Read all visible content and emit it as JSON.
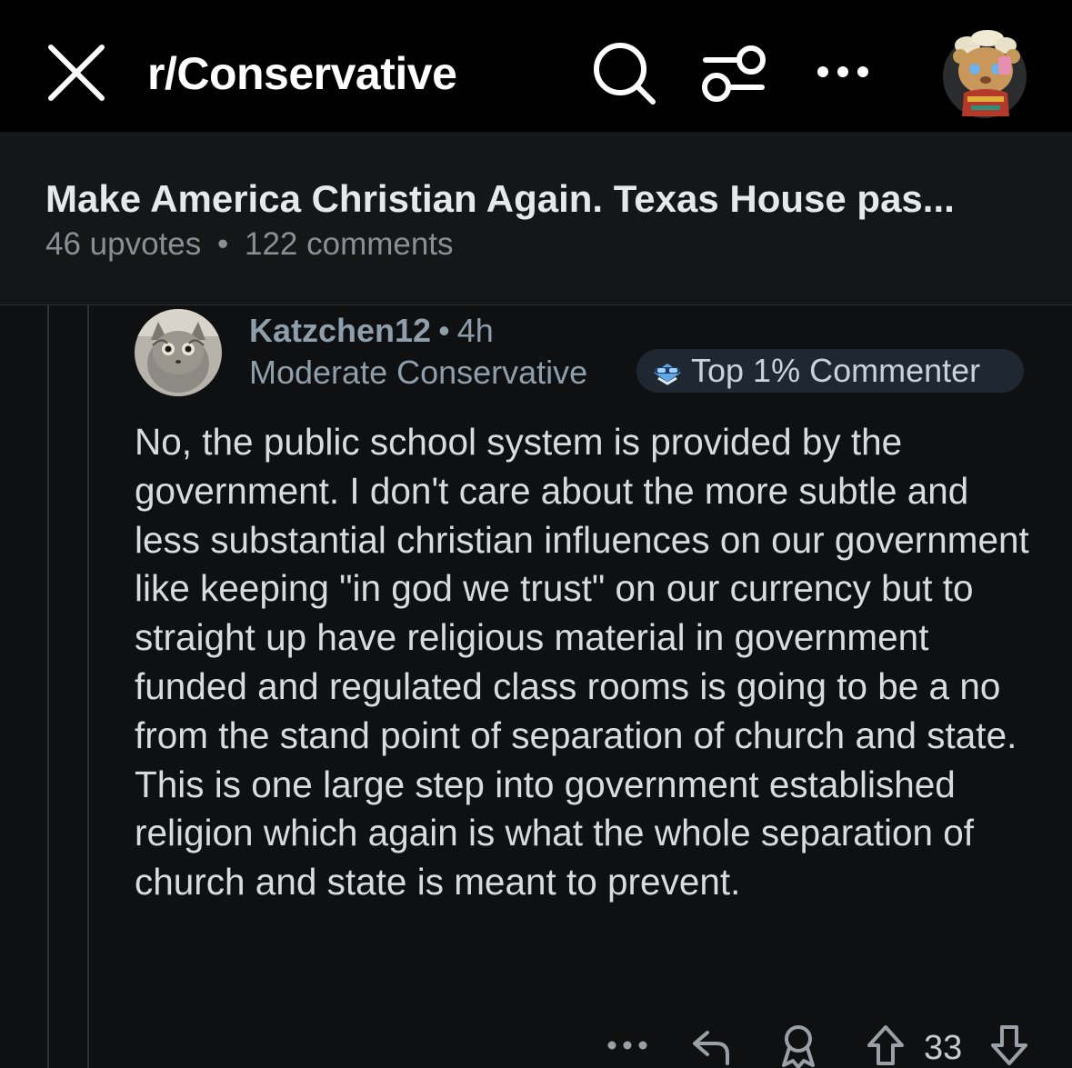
{
  "header": {
    "subreddit": "r/Conservative",
    "icons": [
      "close-icon",
      "search-icon",
      "filter-icon",
      "more-icon",
      "avatar"
    ]
  },
  "post": {
    "title": "Make America Christian Again. Texas House pas...",
    "upvotes": "46 upvotes",
    "separator": "•",
    "comments": "122 comments"
  },
  "comment": {
    "username": "Katzchen12",
    "separator": "•",
    "age": "4h",
    "flair": "Moderate Conservative",
    "badge": "Top 1% Commenter",
    "body": "No, the public school system is provided by the government. I don't care about the more subtle and less substantial christian influences on our government like keeping \"in god we trust\" on our currency but to straight up have religious material in government funded and regulated class rooms is going to be a no from the stand point of separation of church and state. This is one large step into government established religion which again is what the whole separation of church and state is meant to prevent.",
    "score": "33",
    "actions": [
      "more-icon",
      "reply-icon",
      "award-icon",
      "upvote-icon",
      "downvote-icon"
    ]
  },
  "colors": {
    "background": "#0e1012",
    "topbar": "#000000",
    "post_header": "#151618",
    "meta_text": "#8e9eab"
  }
}
